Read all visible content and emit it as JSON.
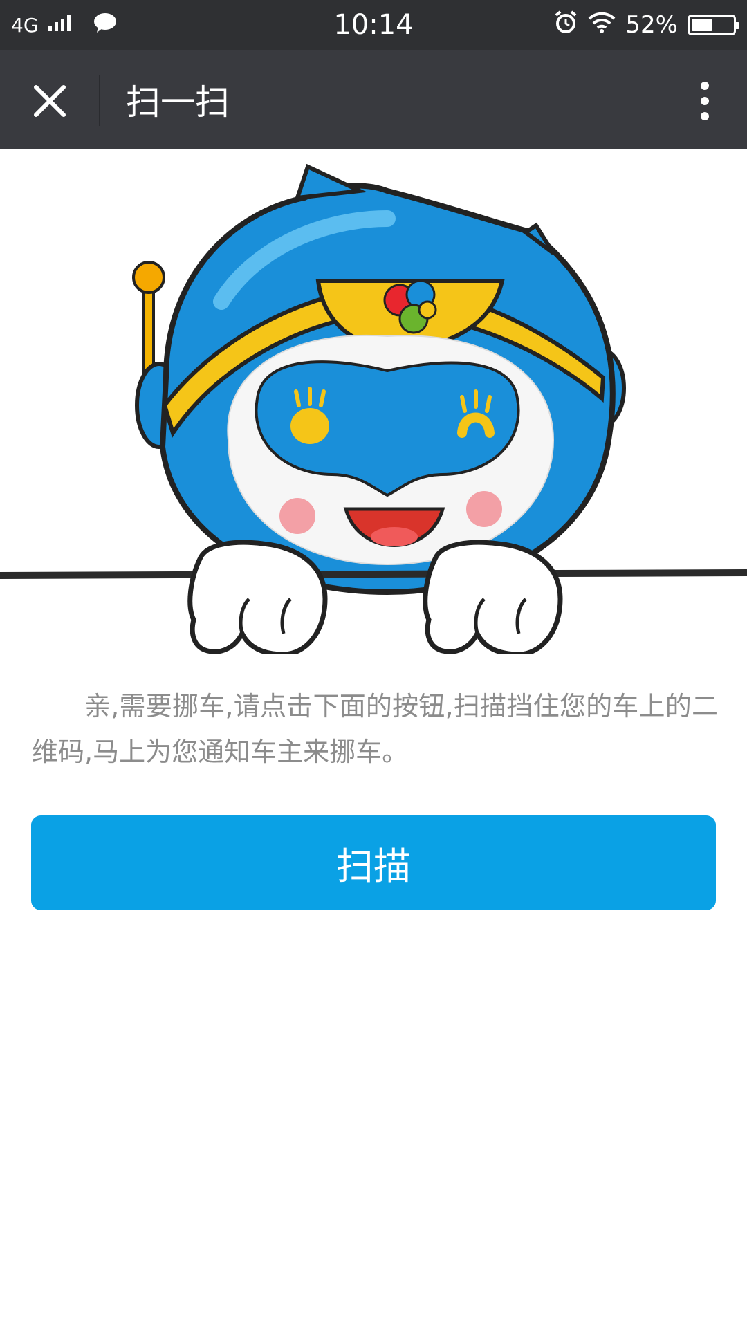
{
  "status_bar": {
    "network": "4G",
    "time": "10:14",
    "battery_percent": "52%",
    "battery_level": 0.52,
    "icons": [
      "signal-icon",
      "wechat-message-icon",
      "alarm-icon",
      "wifi-icon",
      "battery-icon"
    ]
  },
  "nav": {
    "title": "扫一扫",
    "close_icon": "close-icon",
    "more_icon": "more-vertical-icon"
  },
  "content": {
    "description": "亲,需要挪车,请点击下面的按钮,扫描挡住您的车上的二维码,马上为您通知车主来挪车。",
    "scan_button_label": "扫描"
  },
  "colors": {
    "status_bar_bg": "#2f3033",
    "nav_bar_bg": "#393a3f",
    "button_bg": "#0aa1e5",
    "text_gray": "#8c8c8c",
    "mascot_blue": "#1a8fd9",
    "mascot_yellow": "#f5c518"
  }
}
